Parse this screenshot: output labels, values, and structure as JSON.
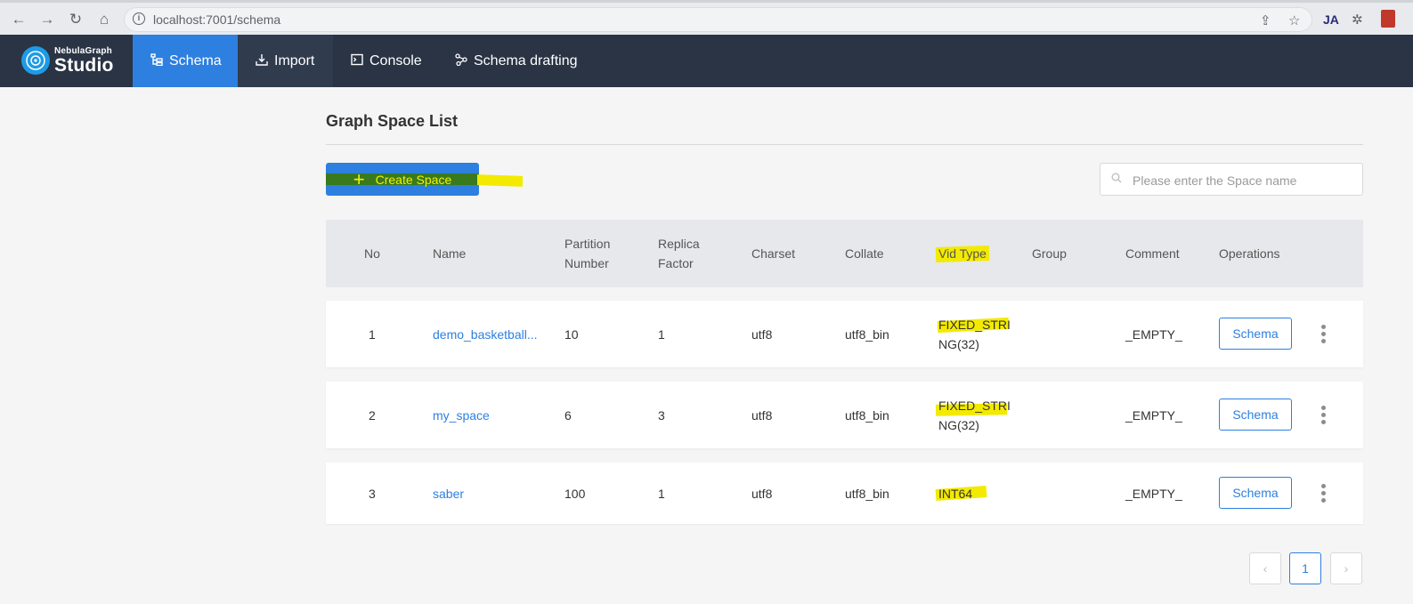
{
  "browser": {
    "url": "localhost:7001/schema"
  },
  "app": {
    "logo_top": "NebulaGraph",
    "logo_main": "Studio",
    "nav": [
      {
        "label": "Schema",
        "icon": "schema-tree-icon"
      },
      {
        "label": "Import",
        "icon": "import-icon"
      },
      {
        "label": "Console",
        "icon": "console-icon"
      },
      {
        "label": "Schema drafting",
        "icon": "schema-drafting-icon"
      }
    ]
  },
  "page": {
    "title": "Graph Space List",
    "create_button": "Create Space",
    "search_placeholder": "Please enter the Space name"
  },
  "table": {
    "headers": {
      "no": "No",
      "name": "Name",
      "partition_1": "Partition",
      "partition_2": "Number",
      "replica_1": "Replica",
      "replica_2": "Factor",
      "charset": "Charset",
      "collate": "Collate",
      "vid_type": "Vid Type",
      "group": "Group",
      "comment": "Comment",
      "operations": "Operations"
    },
    "rows": [
      {
        "no": "1",
        "name": "demo_basketball...",
        "partition": "10",
        "replica": "1",
        "charset": "utf8",
        "collate": "utf8_bin",
        "vid_1": "FIXED_STRI",
        "vid_2": "NG(32)",
        "group": "",
        "comment": "_EMPTY_",
        "op": "Schema"
      },
      {
        "no": "2",
        "name": "my_space",
        "partition": "6",
        "replica": "3",
        "charset": "utf8",
        "collate": "utf8_bin",
        "vid_1": "FIXED_STRI",
        "vid_2": "NG(32)",
        "group": "",
        "comment": "_EMPTY_",
        "op": "Schema"
      },
      {
        "no": "3",
        "name": "saber",
        "partition": "100",
        "replica": "1",
        "charset": "utf8",
        "collate": "utf8_bin",
        "vid_1": "INT64",
        "vid_2": "",
        "group": "",
        "comment": "_EMPTY_",
        "op": "Schema"
      }
    ]
  },
  "pagination": {
    "current": "1",
    "prev": "‹",
    "next": "›"
  },
  "colors": {
    "nav_bg": "#2a3445",
    "accent": "#2d7fe0",
    "highlight": "#f3ea00"
  }
}
